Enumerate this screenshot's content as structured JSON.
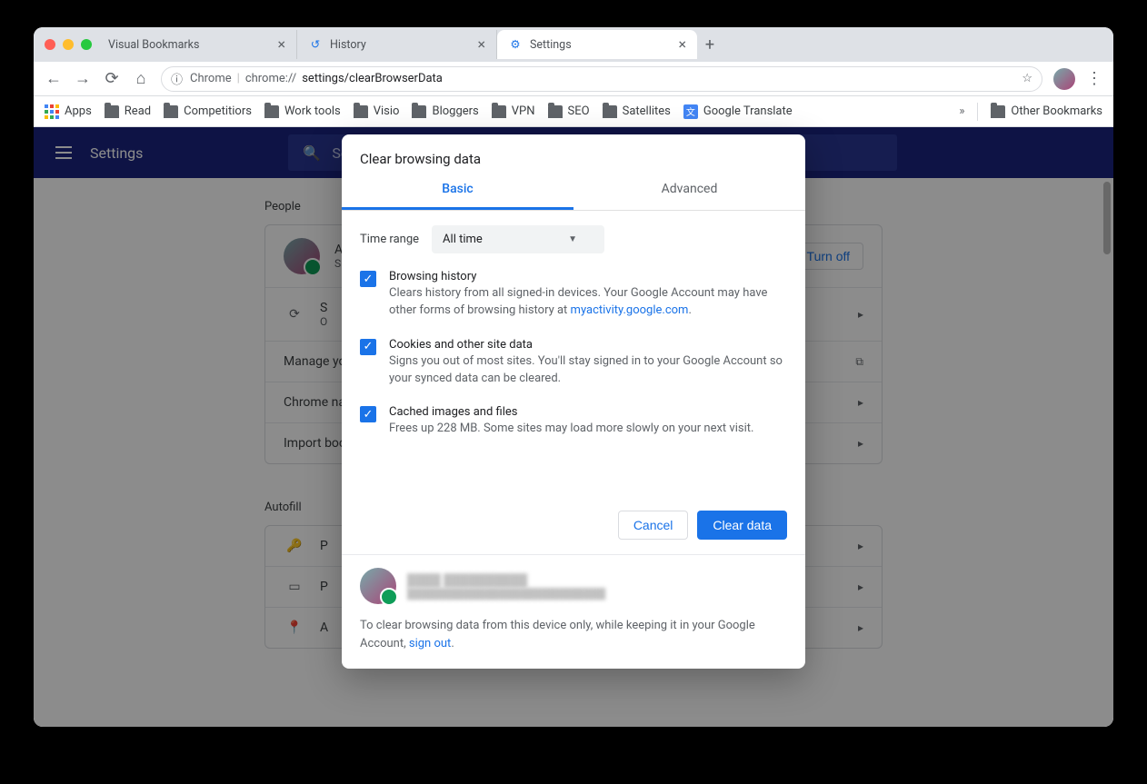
{
  "tabs": [
    {
      "label": "Visual Bookmarks"
    },
    {
      "label": "History"
    },
    {
      "label": "Settings"
    }
  ],
  "address": {
    "app_label": "Chrome",
    "url_part1": "chrome://",
    "url_part2": "settings/clearBrowserData"
  },
  "bookmarks": {
    "apps": "Apps",
    "items": [
      "Read",
      "Competitiors",
      "Work tools",
      "Visio",
      "Bloggers",
      "VPN",
      "SEO",
      "Satellites"
    ],
    "translate": "Google Translate",
    "other": "Other Bookmarks"
  },
  "settings": {
    "title": "Settings",
    "search_placeholder": "Search"
  },
  "people": {
    "section": "People",
    "name_initial": "A",
    "sub_initial": "S",
    "turn_off": "Turn off",
    "sync_initial": "S",
    "sync_sub": "O",
    "manage": "Manage yo",
    "chrome_name": "Chrome na",
    "import": "Import boo"
  },
  "autofill": {
    "section": "Autofill",
    "rows": [
      "P",
      "P",
      "A"
    ]
  },
  "modal": {
    "title": "Clear browsing data",
    "tab_basic": "Basic",
    "tab_advanced": "Advanced",
    "time_range_label": "Time range",
    "time_range_value": "All time",
    "options": [
      {
        "title": "Browsing history",
        "desc": "Clears history from all signed-in devices. Your Google Account may have other forms of browsing history at ",
        "link": "myactivity.google.com",
        "trail": "."
      },
      {
        "title": "Cookies and other site data",
        "desc": "Signs you out of most sites. You'll stay signed in to your Google Account so your synced data can be cleared."
      },
      {
        "title": "Cached images and files",
        "desc": "Frees up 228 MB. Some sites may load more slowly on your next visit."
      }
    ],
    "cancel": "Cancel",
    "clear": "Clear data",
    "account_name_blur": "████ ██████████",
    "account_email_blur": "████████████████████████████",
    "footer_note_pre": "To clear browsing data from this device only, while keeping it in your Google Account, ",
    "footer_link": "sign out",
    "footer_note_post": "."
  }
}
